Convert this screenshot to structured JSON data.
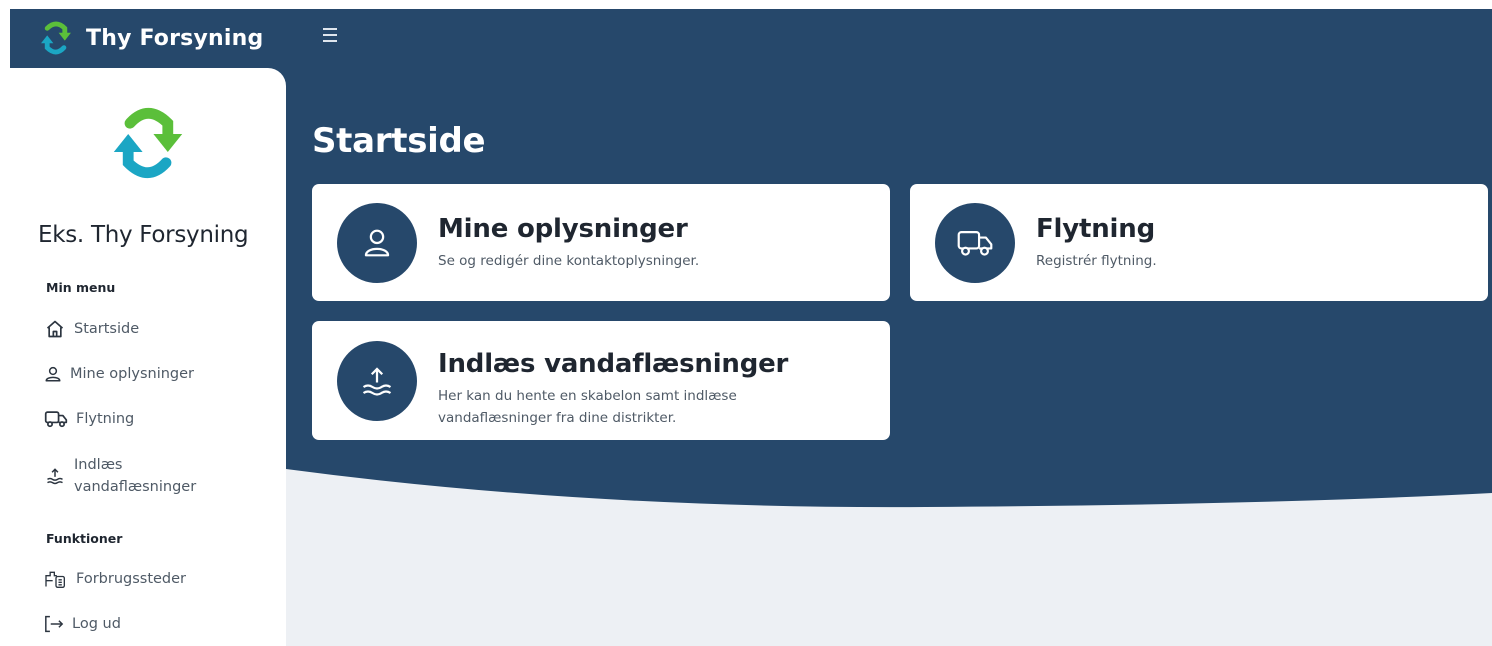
{
  "app": {
    "brand_name": "Thy Forsyning",
    "menu_icon": "hamburger-icon"
  },
  "sidebar": {
    "title": "Eks. Thy Forsyning",
    "sections": [
      {
        "label": "Min menu",
        "items": [
          {
            "label": "Startside",
            "icon": "home-icon"
          },
          {
            "label": "Mine oplysninger",
            "icon": "user-icon"
          },
          {
            "label": "Flytning",
            "icon": "truck-icon"
          },
          {
            "label": "Indlæs vandaflæsninger",
            "label_line1": "Indlæs",
            "label_line2": "vandaflæsninger",
            "icon": "water-upload-icon"
          }
        ]
      },
      {
        "label": "Funktioner",
        "items": [
          {
            "label": "Forbrugssteder",
            "icon": "building-doc-icon"
          },
          {
            "label": "Log ud",
            "icon": "logout-icon"
          }
        ]
      }
    ]
  },
  "main": {
    "page_title": "Startside",
    "cards": [
      {
        "title": "Mine oplysninger",
        "description": "Se og redigér dine kontaktoplysninger.",
        "icon": "user-icon"
      },
      {
        "title": "Flytning",
        "description": "Registrér flytning.",
        "icon": "truck-icon"
      },
      {
        "title": "Indlæs vandaflæsninger",
        "description": "Her kan du hente en skabelon samt indlæse vandaflæsninger fra dine distrikter.",
        "description_line1": "Her kan du hente en skabelon samt indlæse",
        "description_line2": "vandaflæsninger fra dine distrikter.",
        "icon": "water-upload-icon"
      }
    ]
  },
  "colors": {
    "primary": "#26486b",
    "background_light": "#edf0f4",
    "logo_green": "#5bbf3a",
    "logo_teal": "#1ba6c4"
  }
}
